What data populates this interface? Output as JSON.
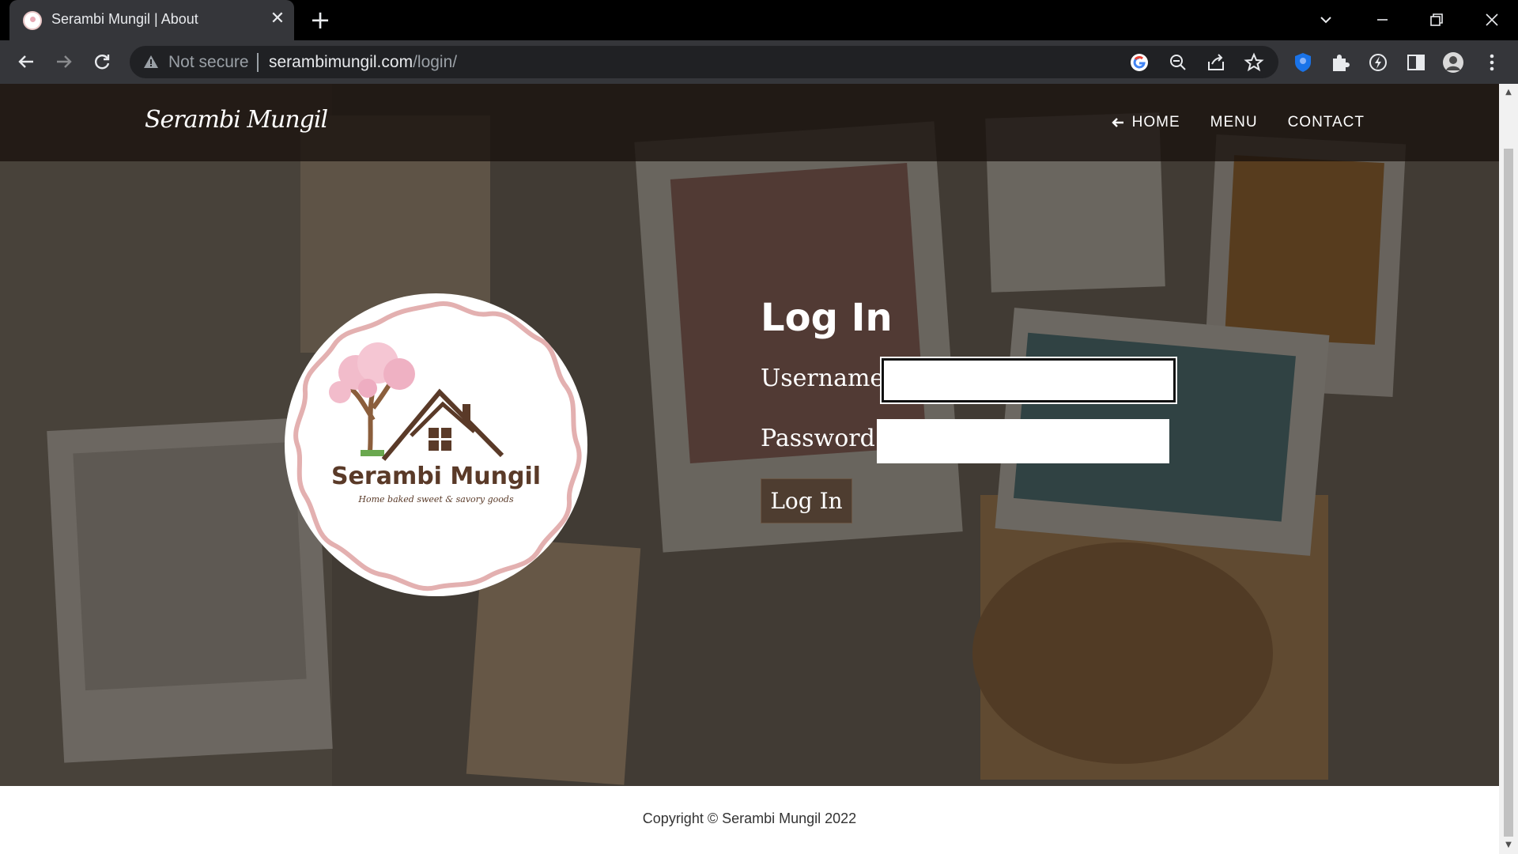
{
  "browser": {
    "tab_title": "Serambi Mungil | About",
    "tab_close_glyph": "✕",
    "new_tab_glyph": "+",
    "not_secure": "Not secure",
    "url_domain": "serambimungil.com",
    "url_path": "/login/"
  },
  "site": {
    "brand": "Serambi Mungil",
    "nav": [
      {
        "label": "HOME",
        "icon": "arrow-left-icon"
      },
      {
        "label": "MENU"
      },
      {
        "label": "CONTACT"
      }
    ]
  },
  "logo": {
    "name": "Serambi Mungil",
    "tagline": "Home baked sweet & savory goods"
  },
  "login": {
    "title": "Log In",
    "username_label": "Username:",
    "username_value": "",
    "password_label": "Password:",
    "password_value": "",
    "submit_label": "Log In"
  },
  "footer": {
    "copyright": "Copyright © Serambi Mungil 2022"
  },
  "colors": {
    "chrome_dark": "#35363a",
    "tab_strip": "#000000",
    "nav_overlay": "#18110d",
    "logo_pink": "#e7b3b3",
    "logo_brown": "#5a3a28",
    "button_brown": "#4e3d30"
  }
}
